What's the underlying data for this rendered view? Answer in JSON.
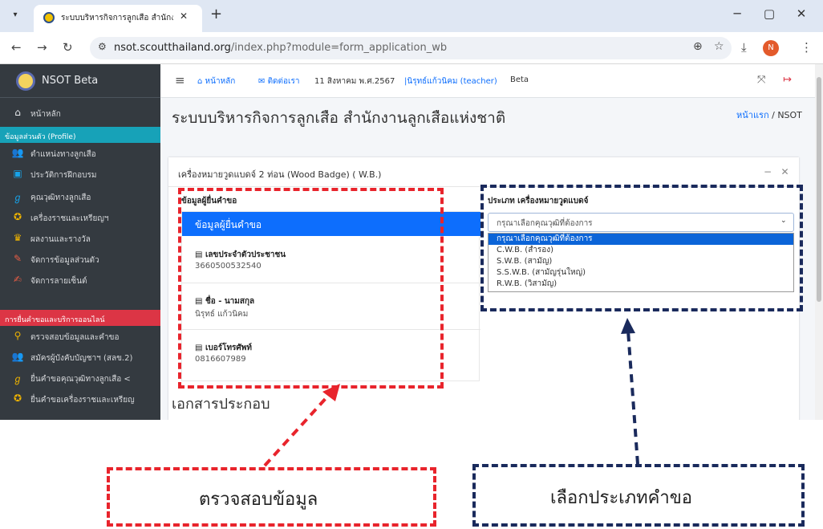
{
  "browser": {
    "tab_title": "ระบบบริหารกิจการลูกเสือ สำนักงานลู",
    "url_host": "nsot.scoutthailand.org",
    "url_path": "/index.php?module=form_application_wb",
    "profile_initial": "N"
  },
  "sidebar": {
    "brand": "NSOT Beta",
    "home": "หน้าหลัก",
    "section_profile": "ข้อมูลส่วนตัว (Profile)",
    "items_profile": [
      {
        "label": "ตำแหน่งทางลูกเสือ",
        "icon": "users-icon",
        "color": "#f0b400"
      },
      {
        "label": "ประวัติการฝึกอบรม",
        "icon": "id-card-icon",
        "color": "#17a2e8"
      },
      {
        "label": "คุณวุฒิทางลูกเสือ",
        "icon": "scout-emblem-icon",
        "color": "#17a2e8"
      },
      {
        "label": "เครื่องราชและเหรียญฯ",
        "icon": "medal-icon",
        "color": "#f0b400"
      },
      {
        "label": "ผลงานและรางวัล",
        "icon": "trophy-icon",
        "color": "#f0b400"
      },
      {
        "label": "จัดการข้อมูลส่วนตัว",
        "icon": "user-edit-icon",
        "color": "#e85d45"
      },
      {
        "label": "จัดการลายเซ็นต์",
        "icon": "signature-icon",
        "color": "#e85d45"
      }
    ],
    "section_online": "การยื่นคำขอและบริการออนไลน์",
    "items_online": [
      {
        "label": "ตรวจสอบข้อมูลและคำขอ",
        "icon": "search-icon",
        "color": "#f0b400"
      },
      {
        "label": "สมัครผู้บังคับบัญชาฯ (สลข.2)",
        "icon": "users-icon",
        "color": "#f0b400"
      },
      {
        "label": "ยื่นคำขอคุณวุฒิทางลูกเสือ  <",
        "icon": "scout-emblem-icon",
        "color": "#f0b400"
      },
      {
        "label": "ยื่นคำขอเครื่องราชและเหรียญ",
        "icon": "medal-icon",
        "color": "#f0b400"
      }
    ]
  },
  "topnav": {
    "home": "หน้าหลัก",
    "contact": "ติดต่อเรา",
    "date": "11 สิงหาคม พ.ศ.2567",
    "user": "|นิรุทธ์แก้วนิคม (teacher)",
    "beta": "Beta"
  },
  "content": {
    "page_title": "ระบบบริหารกิจการลูกเสือ สำนักงานลูกเสือแห่งชาติ",
    "breadcrumb_home": "หน้าแรก",
    "breadcrumb_sep": " / ",
    "breadcrumb_current": "NSOT",
    "card_title": "เครื่องหมายวูดแบดจ์ 2 ท่อน (Wood Badge) ( W.B.)",
    "applicant_section": "ข้อมูลผู้ยื่นคำขอ",
    "applicant_header": "ข้อมูลผู้ยื่นคำขอ",
    "fields": [
      {
        "label": "เลขประจำตัวประชาชน",
        "value": "3660500532540"
      },
      {
        "label": "ชื่อ - นามสกุล",
        "value": "นิรุทธ์ แก้วนิคม"
      },
      {
        "label": "เบอร์โทรศัพท์",
        "value": "0816607989"
      }
    ],
    "type_label": "ประเภท เครื่องหมายวูดแบดจ์",
    "select_value": "กรุณาเลือกคุณวุฒิที่ต้องการ",
    "options": [
      "กรุณาเลือกคุณวุฒิที่ต้องการ",
      "C.W.B. (สำรอง)",
      "S.W.B. (สามัญ)",
      "S.S.W.B. (สามัญรุ่นใหญ่)",
      "R.W.B. (วิสามัญ)"
    ],
    "section2": "เอกสารประกอบ"
  },
  "annotations": {
    "left_callout": "ตรวจสอบข้อมูล",
    "right_callout": "เลือกประเภทคำขอ",
    "red": "#e8242c",
    "navy": "#1a2a5c"
  }
}
